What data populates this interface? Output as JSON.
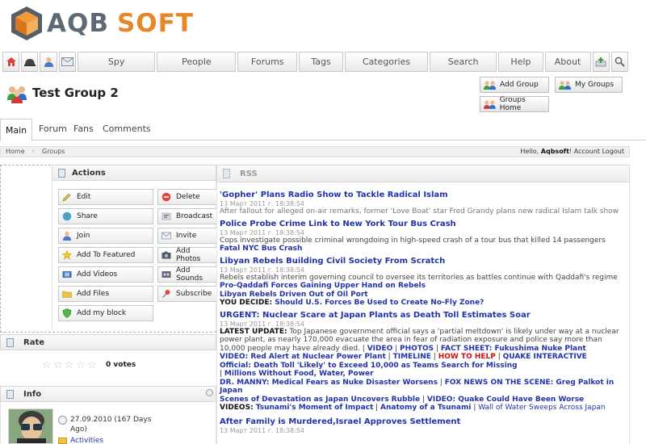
{
  "brand": {
    "part1": "AQB",
    "part2": "SOFT"
  },
  "topnav": {
    "icons": [
      "home-icon",
      "helmet-icon",
      "user-icon",
      "mail-icon"
    ],
    "tabs": [
      {
        "label": "Spy",
        "w": 0
      },
      {
        "label": "People"
      },
      {
        "label": "Forums"
      },
      {
        "label": "Tags"
      },
      {
        "label": "Categories"
      },
      {
        "label": "Search"
      },
      {
        "label": "Help"
      },
      {
        "label": "About"
      }
    ],
    "trailing_icons": [
      "add-icon",
      "search-icon"
    ]
  },
  "page": {
    "title": "Test Group 2"
  },
  "group_buttons": {
    "add_group": "Add Group",
    "my_groups": "My Groups",
    "groups_home": "Groups Home"
  },
  "tabs": {
    "main": "Main",
    "forum": "Forum",
    "fans": "Fans",
    "comments": "Comments"
  },
  "breadcrumb": {
    "home": "Home",
    "groups": "Groups",
    "hello": "Hello, ",
    "user": "Aqbsoft",
    "after_user": "! ",
    "account": "Account",
    "logout": "Logout"
  },
  "actions": {
    "title": "Actions",
    "left": [
      "Edit",
      "Share",
      "Join",
      "Add To Featured",
      "Add Videos",
      "Add Files",
      "Add my block"
    ],
    "right": [
      "Delete",
      "Broadcast",
      "Invite",
      "Add Photos",
      "Add Sounds",
      "Subscribe"
    ]
  },
  "rate": {
    "title": "Rate",
    "votes": "0 votes",
    "stars": 5
  },
  "info": {
    "title": "Info",
    "date": "27.09.2010 (167 Days Ago)",
    "activities": "Activities"
  },
  "rss": {
    "title": "RSS",
    "date": "13 Март 2011 г. 18:38:54",
    "items": {
      "i1_title": "'Gopher' Plans Radio Show to Tackle Radical Islam",
      "i1_desc": "After fallout for alleged on-air remarks, former 'Love Boat' star Fred Grandy plans new radical Islam talk show",
      "i2_title": "Police Probe Crime Link to New York Tour Bus Crash",
      "i2_desc": "Cops investigate possible criminal wrongdoing in high-speed crash of a tour bus that killed 14 passengers",
      "i2_link": "Fatal NYC Bus Crash",
      "i3_title": "Libyan Rebels Building Civil Society From Scratch",
      "i3_desc": "Rebels establish interim governing council to oversee its territories as battles continue with Qaddafi's regime",
      "i3_l1": "Pro-Qaddafi Forces Gaining Upper Hand on Rebels",
      "i3_l2": "Libyan Rebels Driven Out of Oil Port",
      "i3_l3a": "YOU DECIDE:",
      "i3_l3b": " Should U.S. Forces Be Used to Create No-Fly Zone?",
      "i4_title": "URGENT: Nuclear Scare at Japan Plants as Death Toll Estimates Soar",
      "i4_bold": "LATEST UPDATE:",
      "i4_desc": " Top Japanese government official says a 'partial meltdown' is likely under way at a nuclear power plant, as nearly 170,000 evacuate the area in fear of radiation exposure and police say more than 10,000 people may have already died. | ",
      "i4_video": "VIDEO",
      "i4_sep1": " | ",
      "i4_photos": "PHOTOS",
      "i4_sep2": " | ",
      "i4_fact": "FACT SHEET: Fukushima Nuke Plant",
      "i4_line2a": "VIDEO: Red Alert at Nuclear Power Plant",
      "i4_sep3": " | ",
      "i4_timeline": "TIMELINE",
      "i4_sep4": " | ",
      "i4_howto": "HOW TO HELP",
      "i4_sep5": " | ",
      "i4_quake": "QUAKE INTERACTIVE",
      "i4_line3": "Official: Death Toll 'Likely' to Exceed 10,000 as Teams Search for Missing",
      "i4_line4a": "| ",
      "i4_line4b": "Millions Without Food, Water, Power",
      "i4_line5a": "DR. MANNY: Medical Fears as Nuke Disaster Worsens",
      "i4_sep6": " | ",
      "i4_line5b": "FOX NEWS ON THE SCENE: Greg Palkot in Japan",
      "i4_line6a": "Scenes of Devastation as Japan Uncovers Rubble",
      "i4_sep7": " | ",
      "i4_line6b": "VIDEO: Quake Could Have Been Worse",
      "i4_line7a": "VIDEOS:",
      "i4_line7b": " Tsunami's Moment of Impact",
      "i4_sep8": " | ",
      "i4_line7c": "Anatomy of a Tsunami",
      "i4_sep9": " | ",
      "i4_line7d": "Wall of Water Sweeps Across Japan",
      "i5_title": "After Family is Murdered,Israel Approves Settlement"
    }
  }
}
